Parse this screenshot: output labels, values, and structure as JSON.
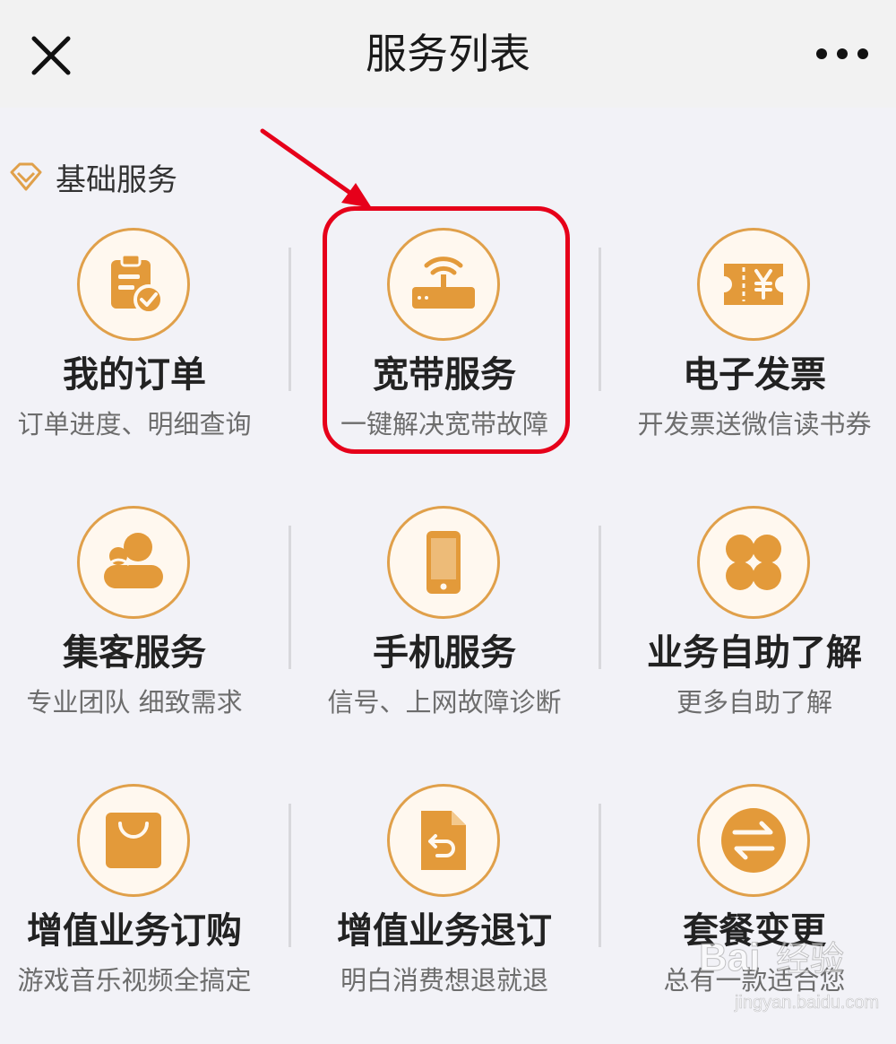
{
  "header": {
    "title": "服务列表"
  },
  "section": {
    "title": "基础服务"
  },
  "tiles": [
    {
      "title": "我的订单",
      "subtitle": "订单进度、明细查询"
    },
    {
      "title": "宽带服务",
      "subtitle": "一键解决宽带故障"
    },
    {
      "title": "电子发票",
      "subtitle": "开发票送微信读书券"
    },
    {
      "title": "集客服务",
      "subtitle": "专业团队 细致需求"
    },
    {
      "title": "手机服务",
      "subtitle": "信号、上网故障诊断"
    },
    {
      "title": "业务自助了解",
      "subtitle": "更多自助了解"
    },
    {
      "title": "增值业务订购",
      "subtitle": "游戏音乐视频全搞定"
    },
    {
      "title": "增值业务退订",
      "subtitle": "明白消费想退就退"
    },
    {
      "title": "套餐变更",
      "subtitle": "总有一款适合您"
    }
  ],
  "watermark": {
    "brand": "Bai经验",
    "url": "jingyan.baidu.com"
  },
  "colors": {
    "accent": "#e0a04a",
    "icon_fill": "#e39a3a",
    "highlight": "#e6001a"
  }
}
